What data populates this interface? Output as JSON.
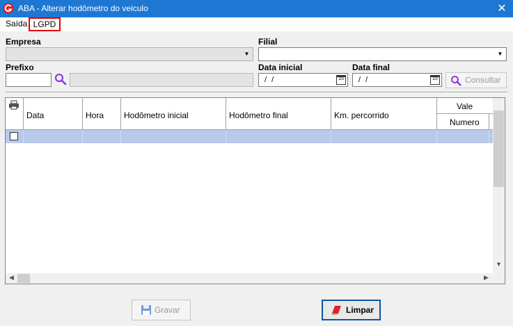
{
  "window": {
    "title": "ABA - Alterar hodômetro do veiculo",
    "close_glyph": "✕"
  },
  "menu": {
    "items": [
      "Saída",
      "LGPD"
    ],
    "highlighted_item": "LGPD",
    "highlight_color": "#e00000"
  },
  "form": {
    "empresa_label": "Empresa",
    "empresa_value": "",
    "filial_label": "Filial",
    "filial_value": "",
    "prefixo_label": "Prefixo",
    "prefixo_value": "",
    "prefixo_description": "",
    "data_inicial_label": "Data inicial",
    "data_inicial_value": " / /",
    "data_final_label": "Data final",
    "data_final_value": " / /",
    "calendar_icon_text": "15",
    "consultar_label": "Consultar"
  },
  "grid": {
    "columns": [
      "Data",
      "Hora",
      "Hodômetro inicial",
      "Hodômetro final",
      "Km. percorrido"
    ],
    "group_header": "Vale",
    "sub_columns": [
      "Numero"
    ],
    "selected_row_color": "#b9c9ea",
    "rows": [
      {
        "checked": false,
        "data": "",
        "hora": "",
        "hodometro_inicial": "",
        "hodometro_final": "",
        "km_percorrido": "",
        "numero": ""
      }
    ]
  },
  "buttons": {
    "gravar_label": "Gravar",
    "limpar_label": "Limpar"
  },
  "colors": {
    "titlebar": "#1e77d3",
    "accent_icon": "#8a2be2"
  }
}
